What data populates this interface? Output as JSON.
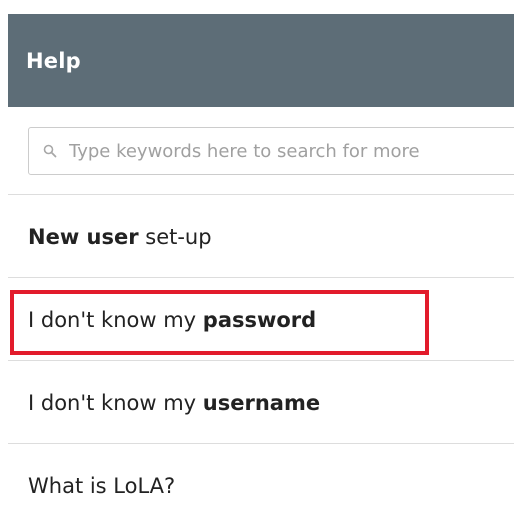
{
  "header": {
    "title": "Help"
  },
  "search": {
    "placeholder": "Type keywords here to search for more"
  },
  "items": [
    {
      "prefix": "",
      "bold": "New user",
      "suffix": " set-up"
    },
    {
      "prefix": "I don't know my ",
      "bold": "password",
      "suffix": ""
    },
    {
      "prefix": "I don't know my ",
      "bold": "username",
      "suffix": ""
    },
    {
      "prefix": "What is LoLA?",
      "bold": "",
      "suffix": ""
    }
  ],
  "colors": {
    "header_bg": "#5d6d77",
    "highlight": "#e21b2b",
    "divider": "#dddddd"
  },
  "icons": {
    "search": "search-icon"
  }
}
